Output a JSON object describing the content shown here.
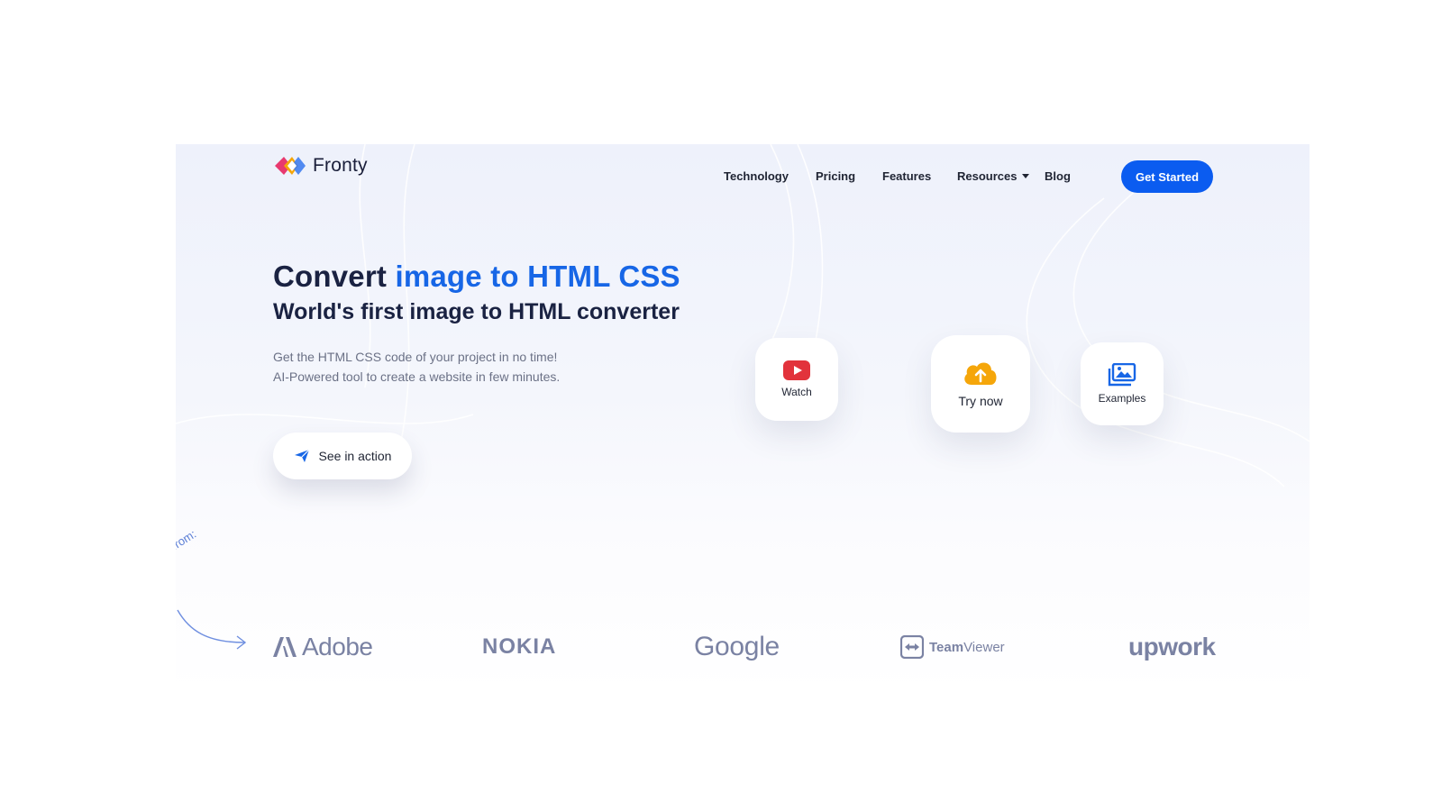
{
  "brand": {
    "name": "Fronty"
  },
  "nav": {
    "items": [
      {
        "label": "Technology"
      },
      {
        "label": "Pricing"
      },
      {
        "label": "Features"
      },
      {
        "label": "Resources"
      },
      {
        "label": "Blog"
      }
    ],
    "cta_label": "Get Started"
  },
  "hero": {
    "title_plain": "Convert ",
    "title_accent": "image to HTML CSS",
    "subtitle": "World's first image to HTML converter",
    "desc_line1": "Get the HTML CSS code of your project in no time!",
    "desc_line2": "AI-Powered tool to create a website in few minutes.",
    "see_action_label": "See in action"
  },
  "cards": {
    "watch": {
      "label": "Watch",
      "icon": "youtube-play-icon"
    },
    "try_now": {
      "label": "Try now",
      "icon": "cloud-upload-icon"
    },
    "examples": {
      "label": "Examples",
      "icon": "images-icon"
    }
  },
  "trusted": {
    "from_label": ". from:",
    "logos": {
      "adobe": "Adobe",
      "nokia": "NOKIA",
      "google": "Google",
      "teamviewer_bold": "Team",
      "teamviewer_rest": "Viewer",
      "upwork": "upwork"
    }
  },
  "colors": {
    "accent": "#1766e6",
    "cta": "#0b5cf0",
    "heading": "#1a2242",
    "logo_gray": "#7a82a3",
    "watch_red": "#e2333c",
    "try_orange": "#f5a60a"
  }
}
